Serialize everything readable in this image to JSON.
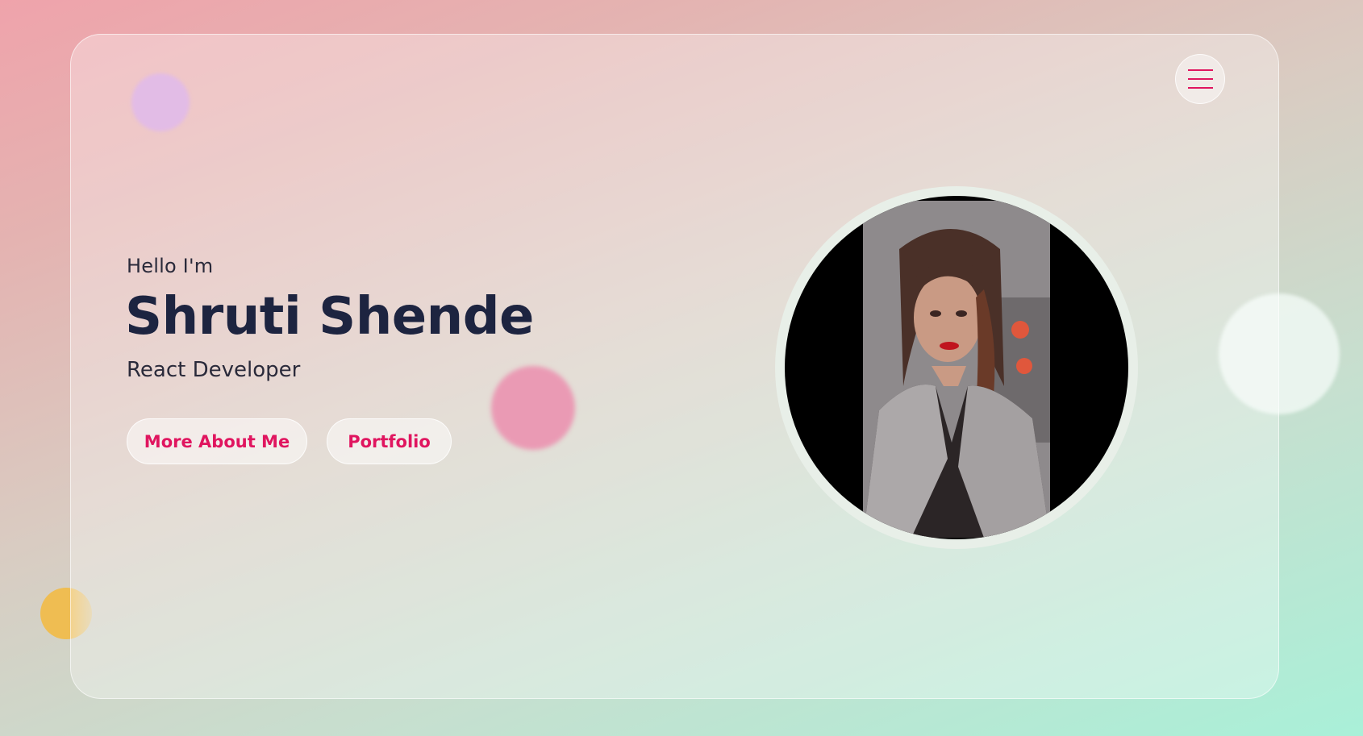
{
  "hero": {
    "greeting": "Hello I'm",
    "name": "Shruti Shende",
    "role": "React Developer"
  },
  "buttons": {
    "more_about": "More About Me",
    "portfolio": "Portfolio"
  },
  "colors": {
    "accent": "#e0155f",
    "name_text": "#1d2440"
  },
  "icons": {
    "menu": "hamburger-menu-icon"
  }
}
